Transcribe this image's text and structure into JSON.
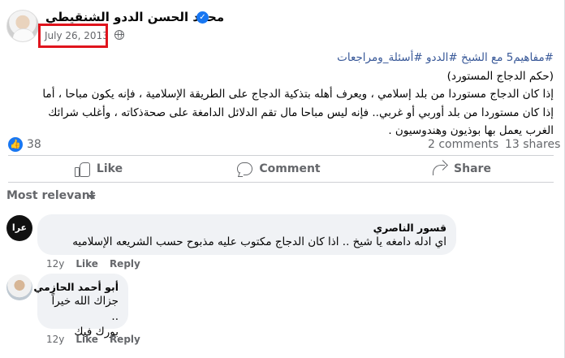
{
  "post": {
    "author_name": "محمد الحسن الددو الشنقيطي",
    "date": "July 26, 2013",
    "hashtags_line": "#مفاهيم5 مع الشيخ #الددو #أسئلة_ومراجعات",
    "title_line": "(حكم الدجاج المستورد)",
    "body_line_1": "إذا كان الدجاج مستوردا من بلد إسلامي ، ويعرف أهله بتذكية الدجاج على الطريقة الإسلامية ، فإنه يكون مباحا ، أما",
    "body_line_2": "إذا كان مستوردا من بلد أوربي أو غربي.. فإنه ليس مباحا مال تقم الدلائل الدامغة على صحةذكاته ، وأغلب شرائك",
    "body_line_3": "الغرب يعمل بها بوذيون وهندوسيون ."
  },
  "stats": {
    "reaction_count": "38",
    "comments": "2 comments",
    "shares": "13 shares"
  },
  "actions": {
    "like": "Like",
    "comment": "Comment",
    "share": "Share"
  },
  "comments_section": {
    "sort_label": "Most relevant",
    "comments": [
      {
        "name": "قسور الناصري",
        "text": "اي ادله دامغه يا شيخ .. اذا كان الدجاج مكتوب عليه مذبوح حسب الشريعه الإسلاميه",
        "time": "12y",
        "like": "Like",
        "reply": "Reply",
        "avatar_text": "عرا"
      },
      {
        "name": "أبو أحمد الحازمي",
        "text_line_1": "جزاك الله خيراً ..",
        "text_line_2": "بورك فيك",
        "time": "12y",
        "like": "Like",
        "reply": "Reply"
      }
    ]
  },
  "colors": {
    "accent": "#1877f2",
    "hashtag": "#385898",
    "highlight_box": "#e0141d",
    "secondary_text": "#65676b"
  }
}
